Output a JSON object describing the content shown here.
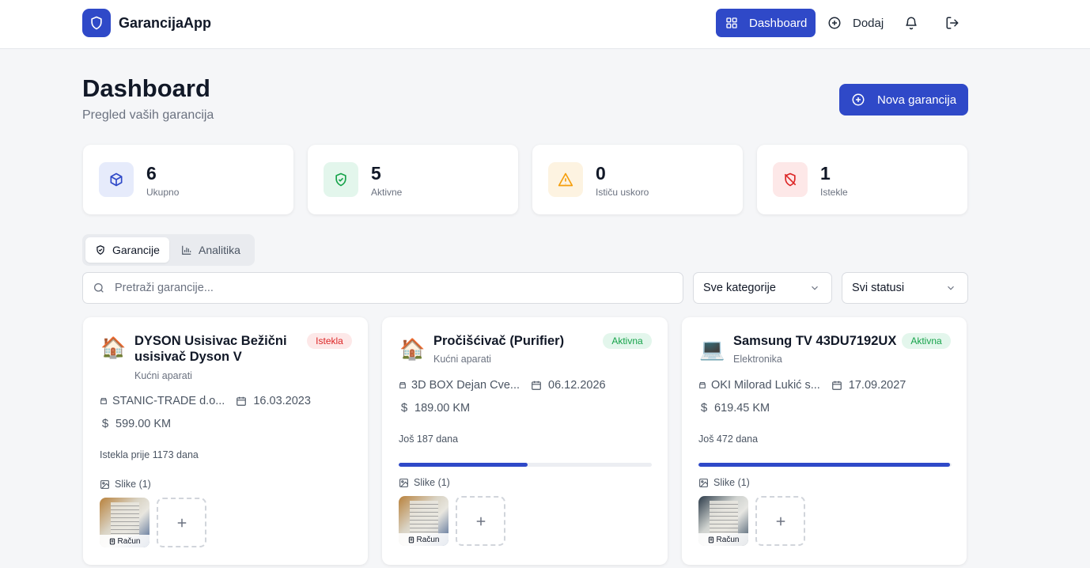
{
  "app": {
    "name": "GarancijaApp"
  },
  "nav": {
    "dashboard": "Dashboard",
    "add": "Dodaj"
  },
  "header": {
    "title": "Dashboard",
    "subtitle": "Pregled vaših garancija",
    "new_button": "Nova garancija"
  },
  "stats": [
    {
      "value": "6",
      "label": "Ukupno",
      "icon": "box-icon"
    },
    {
      "value": "5",
      "label": "Aktivne",
      "icon": "shield-check-icon"
    },
    {
      "value": "0",
      "label": "Ističu uskoro",
      "icon": "warning-icon"
    },
    {
      "value": "1",
      "label": "Istekle",
      "icon": "shield-off-icon"
    }
  ],
  "tabs": {
    "warranties": "Garancije",
    "analytics": "Analitika"
  },
  "filters": {
    "search_placeholder": "Pretraži garancije...",
    "category": "Sve kategorije",
    "status": "Svi statusi"
  },
  "cards": [
    {
      "emoji": "🏠",
      "title_line1": "DYSON Usisivac Bežični",
      "title_line2": "usisivač Dyson V",
      "category": "Kućni aparati",
      "status": "Istekla",
      "store": "STANIC-TRADE d.o...",
      "date": "16.03.2023",
      "price": "599.00 KM",
      "days": "Istekla prije 1173 dana",
      "images_label": "Slike (1)",
      "thumb_caption": "Račun"
    },
    {
      "emoji": "🏠",
      "title_line1": "Pročišćivač (Purifier)",
      "category": "Kućni aparati",
      "status": "Aktivna",
      "store": "3D BOX Dejan Cve...",
      "date": "06.12.2026",
      "price": "189.00 KM",
      "days": "Još 187 dana",
      "progress": 0.51,
      "images_label": "Slike (1)",
      "thumb_caption": "Račun"
    },
    {
      "emoji": "💻",
      "title_line1": "Samsung TV 43DU7192UX",
      "category": "Elektronika",
      "status": "Aktivna",
      "store": "OKI Milorad Lukić s...",
      "date": "17.09.2027",
      "price": "619.45 KM",
      "days": "Još 472 dana",
      "progress": 0.995,
      "images_label": "Slike (1)",
      "thumb_caption": "Račun"
    }
  ],
  "colors": {
    "primary": "#2f49c8",
    "danger": "#dc2626",
    "success": "#16a34a",
    "warning": "#f59e0b"
  }
}
